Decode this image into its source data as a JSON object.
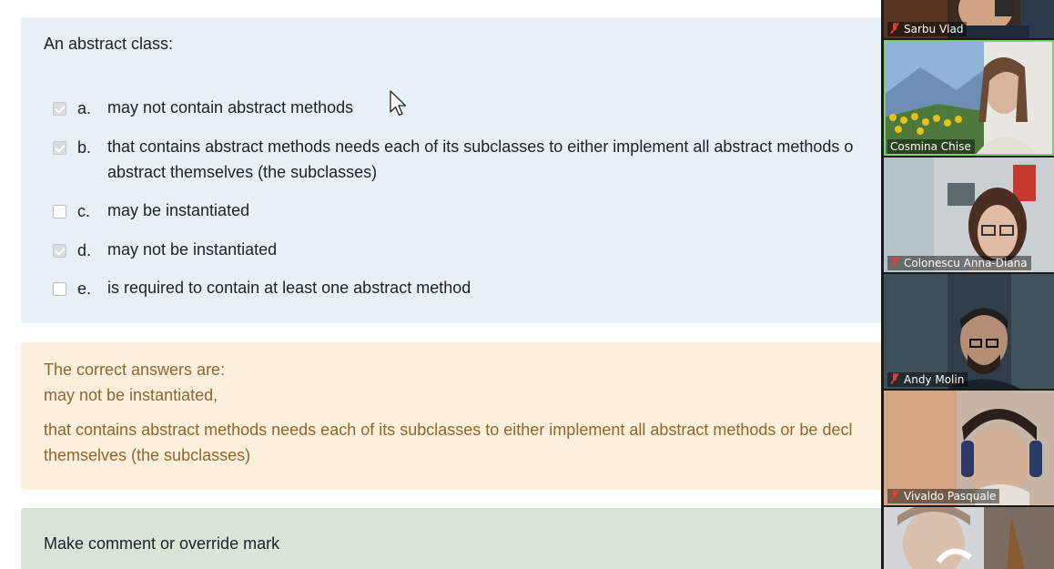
{
  "question": {
    "prompt": "An abstract class:",
    "options": [
      {
        "letter": "a.",
        "text": "may not contain abstract methods",
        "checked": true
      },
      {
        "letter": "b.",
        "text": "that contains abstract methods needs each of its subclasses to either implement all abstract methods o",
        "text2": "abstract themselves (the subclasses)",
        "checked": true
      },
      {
        "letter": "c.",
        "text": "may be instantiated",
        "checked": false
      },
      {
        "letter": "d.",
        "text": "may not be instantiated",
        "checked": true
      },
      {
        "letter": "e.",
        "text": "is required to contain at least one abstract method",
        "checked": false
      }
    ]
  },
  "feedback": {
    "heading": "The correct answers are:",
    "answer1": "may not be instantiated,",
    "answer2_line1": "that contains abstract methods needs each of its subclasses to either implement all abstract methods or be decl",
    "answer2_line2": "themselves (the subclasses)"
  },
  "comment": {
    "link_text": "Make comment or override mark"
  },
  "participants": [
    {
      "name": "Sarbu Vlad",
      "muted": true
    },
    {
      "name": "Cosmina Chise",
      "muted": false
    },
    {
      "name": "Colonescu Anna-Diana",
      "muted": true
    },
    {
      "name": "Andy Molin",
      "muted": true
    },
    {
      "name": "Vivaldo Pasquale",
      "muted": true
    }
  ],
  "colors": {
    "question_bg": "#e7f0f7",
    "feedback_bg": "#fcefdc",
    "feedback_text": "#8e662e",
    "comment_bg": "#d7e4d6",
    "active_speaker": "#7ad36a",
    "muted_icon": "#e23b3b"
  }
}
